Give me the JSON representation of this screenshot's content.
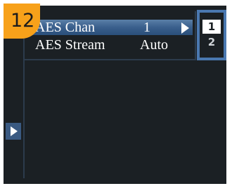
{
  "callout": {
    "number": "12"
  },
  "menu": {
    "items": [
      {
        "label": "AES Chan",
        "value": "1",
        "selected": true
      },
      {
        "label": "AES Stream",
        "value": "Auto",
        "selected": false
      }
    ]
  },
  "submenu": {
    "options": [
      {
        "label": "1",
        "selected": true
      },
      {
        "label": "2",
        "selected": false
      }
    ]
  },
  "colors": {
    "background": "#1b2024",
    "selection": "#3a5f8c",
    "submenu_border": "#4a78b0",
    "callout": "#f7a11a"
  },
  "icons": {
    "submenu_arrow": "chevron-right-icon",
    "side_arrow": "scroll-right-icon"
  }
}
